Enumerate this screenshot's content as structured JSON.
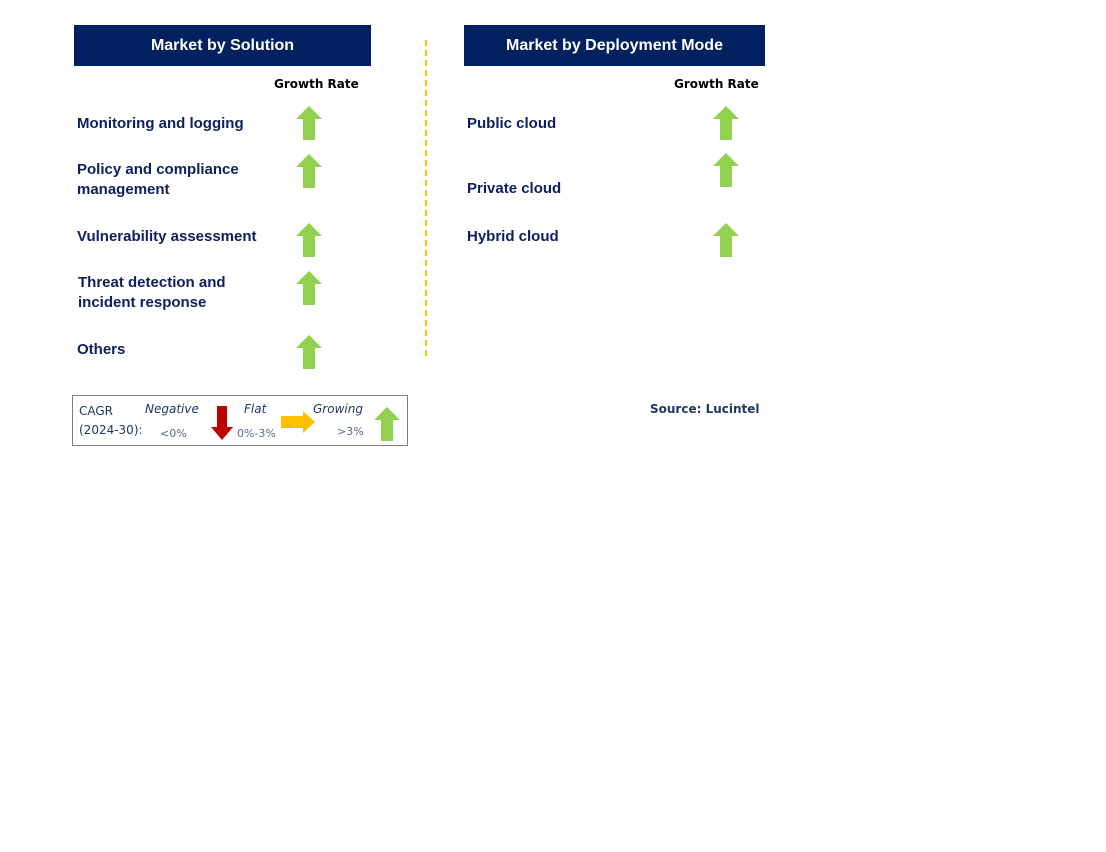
{
  "colors": {
    "header_bg": "#002060",
    "header_text": "#ffffff",
    "item_text": "#0d1f5c",
    "growing_arrow": "#92d050",
    "flat_arrow": "#ffc000",
    "negative_arrow": "#c00000",
    "divider": "#ffc000"
  },
  "left_panel": {
    "title": "Market by Solution",
    "column_header": "Growth Rate",
    "items": [
      {
        "label": "Monitoring and logging",
        "trend": "growing",
        "icon": "up-arrow-icon"
      },
      {
        "label": "Policy and compliance management",
        "trend": "growing",
        "icon": "up-arrow-icon"
      },
      {
        "label": "Vulnerability assessment",
        "trend": "growing",
        "icon": "up-arrow-icon"
      },
      {
        "label": "Threat detection and incident response",
        "trend": "growing",
        "icon": "up-arrow-icon"
      },
      {
        "label": "Others",
        "trend": "growing",
        "icon": "up-arrow-icon"
      }
    ]
  },
  "right_panel": {
    "title": "Market by Deployment Mode",
    "column_header": "Growth Rate",
    "items": [
      {
        "label": "Public cloud",
        "trend": "growing",
        "icon": "up-arrow-icon"
      },
      {
        "label": "Private cloud",
        "trend": "growing",
        "icon": "up-arrow-icon"
      },
      {
        "label": "Hybrid cloud",
        "trend": "growing",
        "icon": "up-arrow-icon"
      }
    ]
  },
  "legend": {
    "label_line1": "CAGR",
    "label_line2": "(2024-30):",
    "negative": {
      "label": "Negative",
      "range": "<0%",
      "icon": "down-arrow-icon"
    },
    "flat": {
      "label": "Flat",
      "range": "0%-3%",
      "icon": "right-arrow-icon"
    },
    "growing": {
      "label": "Growing",
      "range": ">3%",
      "icon": "up-arrow-icon"
    }
  },
  "source": "Source: Lucintel"
}
